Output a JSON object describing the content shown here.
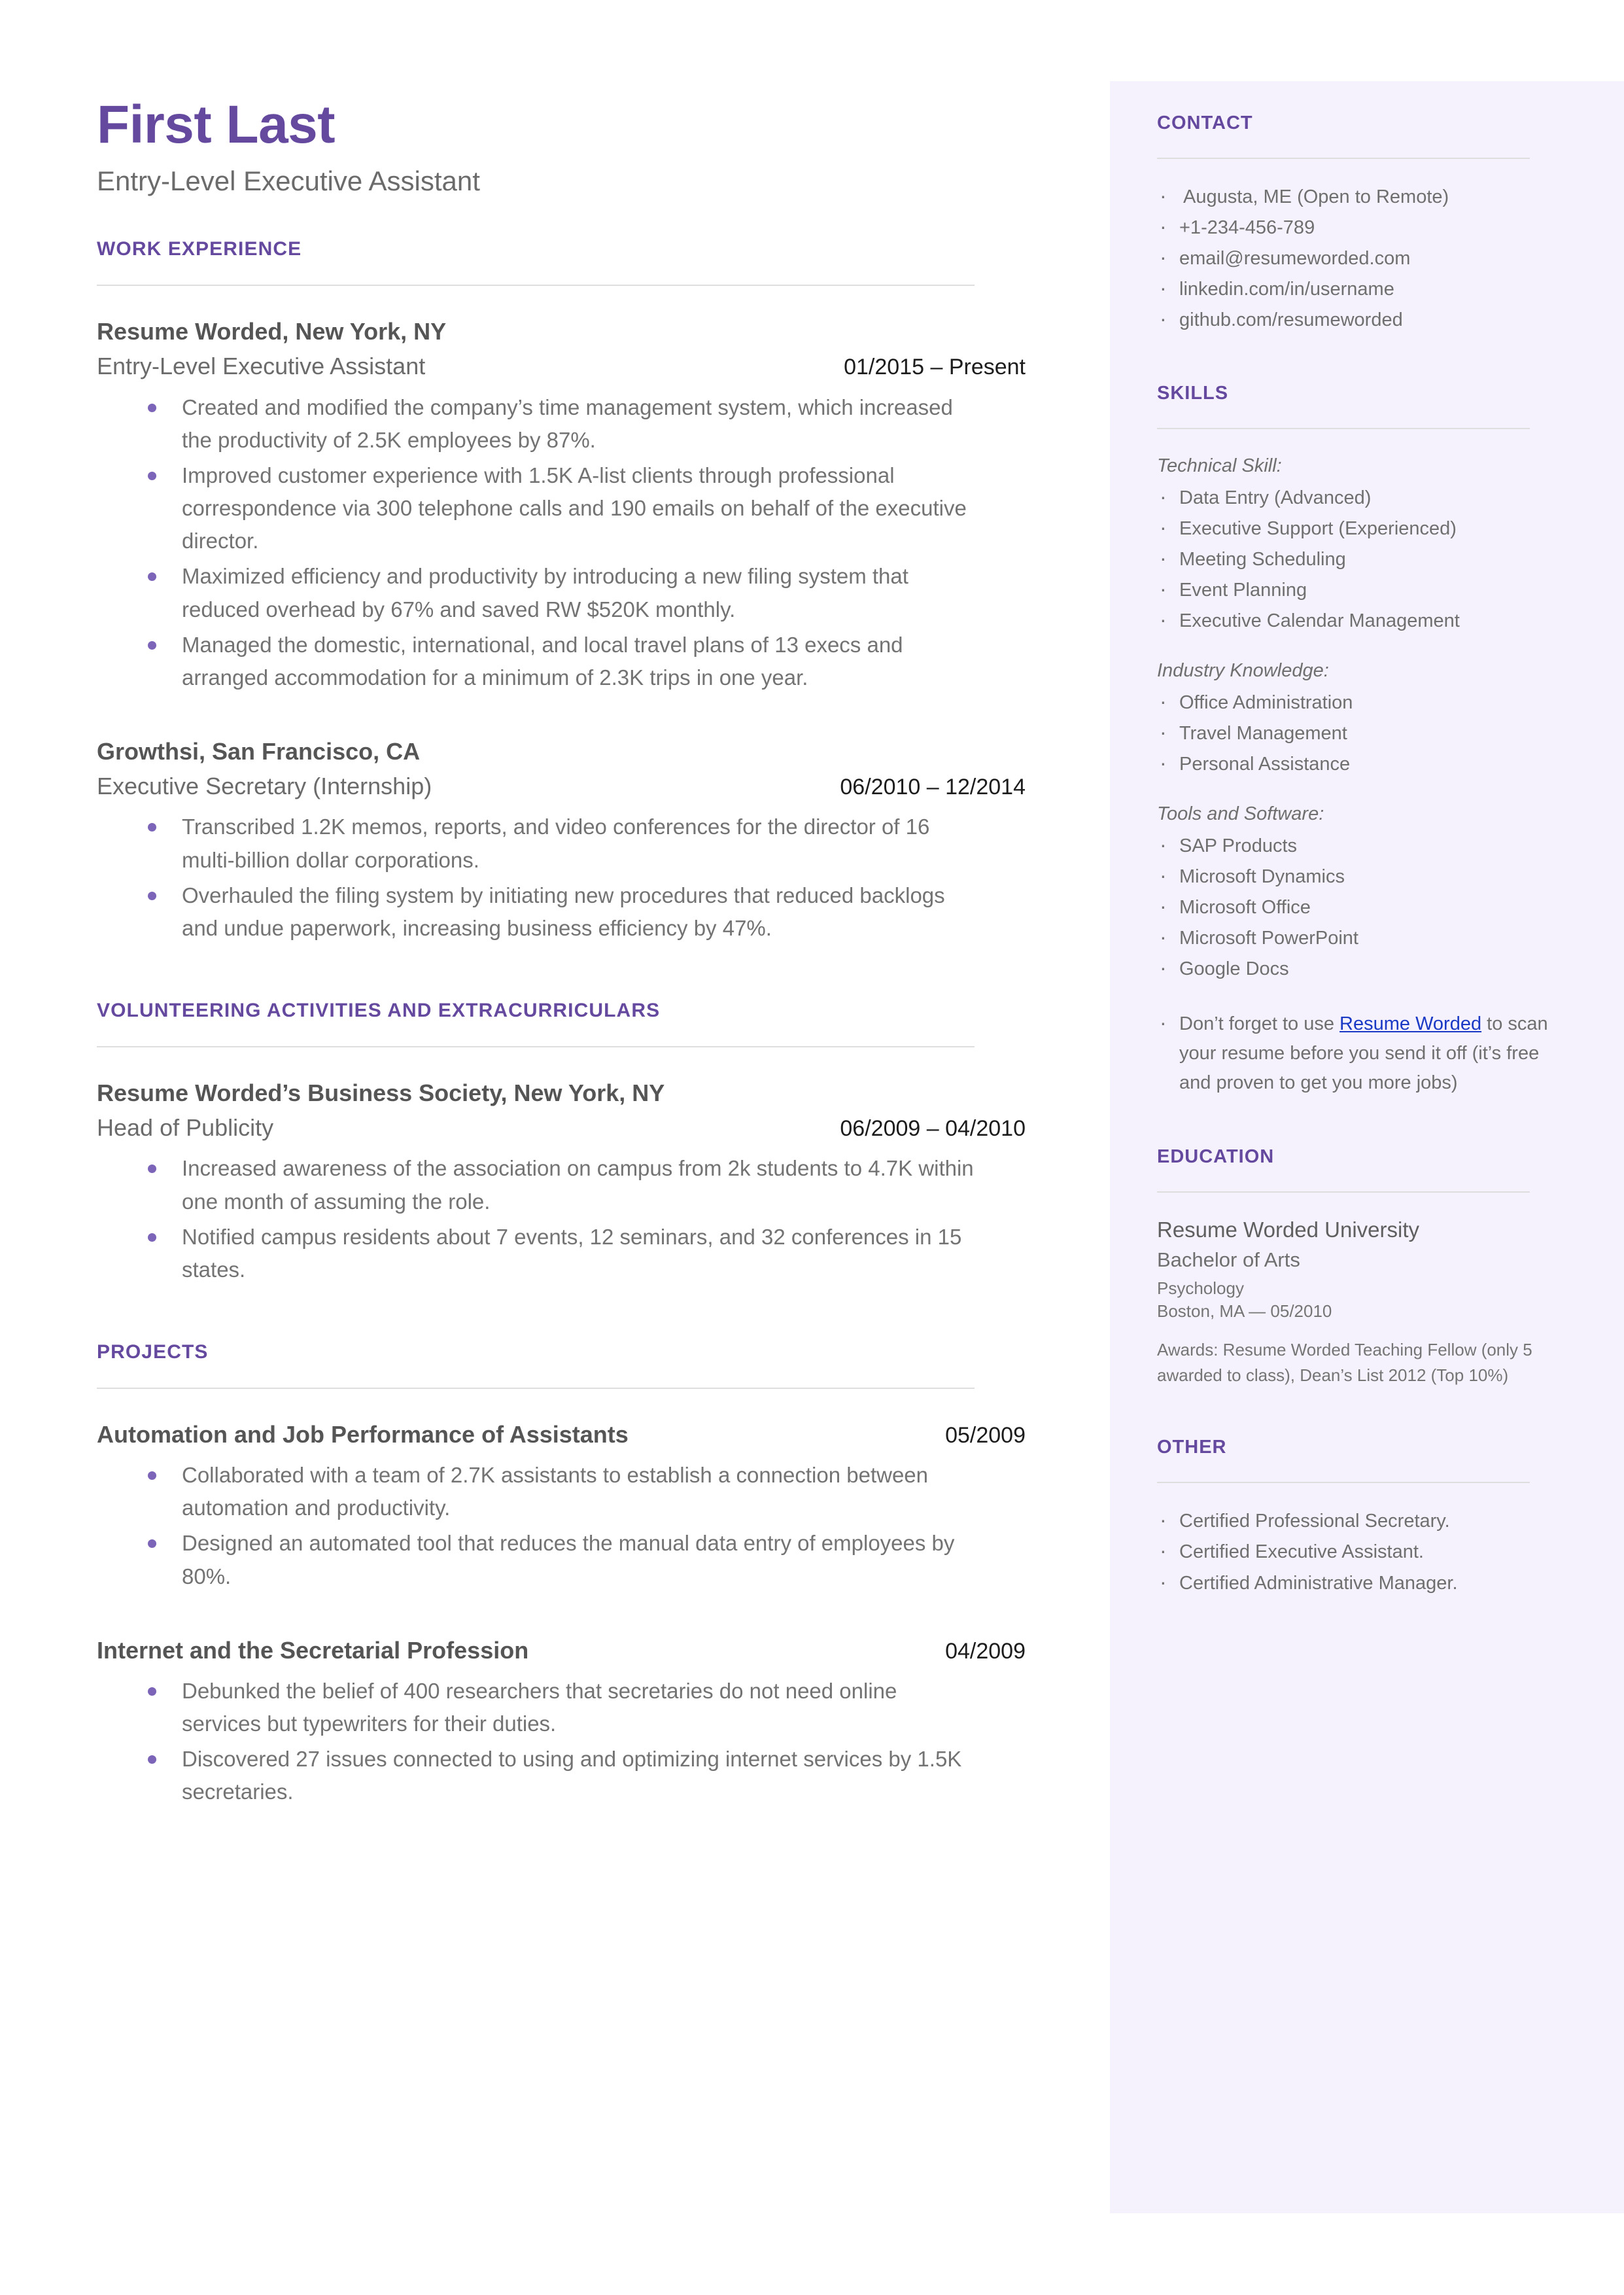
{
  "colors": {
    "accent_purple": "#64499E",
    "bullet_purple": "#7C64B8",
    "sidebar_bg": "#F5F2FD",
    "link_blue": "#1A39C4",
    "body_gray": "#737373",
    "date_black": "#1C1C1C"
  },
  "header": {
    "name": "First Last",
    "headline": "Entry-Level Executive Assistant"
  },
  "sections": {
    "work_experience": {
      "title": "WORK EXPERIENCE",
      "entries": [
        {
          "organization": "Resume Worded, New York, NY",
          "role": "Entry-Level Executive Assistant",
          "date": "01/2015 – Present",
          "bullets": [
            "Created and modified the company’s time management system, which increased the productivity of 2.5K employees by 87%.",
            "Improved customer experience with 1.5K A-list clients through professional correspondence via 300 telephone calls and 190 emails on behalf of the executive director.",
            "Maximized efficiency and productivity by introducing a new filing system that reduced overhead by 67% and saved RW $520K monthly.",
            "Managed the domestic, international, and local travel plans of 13 execs and arranged accommodation for a minimum of 2.3K trips in one year."
          ]
        },
        {
          "organization": "Growthsi, San Francisco, CA",
          "role": "Executive Secretary (Internship)",
          "date": "06/2010 – 12/2014",
          "bullets": [
            "Transcribed 1.2K memos, reports, and video conferences for the director of 16 multi-billion dollar corporations.",
            "Overhauled the filing system by initiating new procedures that reduced backlogs and undue paperwork, increasing business efficiency by 47%."
          ]
        }
      ]
    },
    "volunteering": {
      "title": "VOLUNTEERING ACTIVITIES AND EXTRACURRICULARS",
      "entries": [
        {
          "organization": "Resume Worded’s Business Society, New York, NY",
          "role": "Head of Publicity",
          "date": "06/2009 – 04/2010",
          "bullets": [
            "Increased awareness of the association on campus from 2k students to 4.7K within one month of assuming the role.",
            "Notified campus residents about 7 events, 12 seminars, and 32 conferences in 15 states."
          ]
        }
      ]
    },
    "projects": {
      "title": "PROJECTS",
      "entries": [
        {
          "name": "Automation and Job Performance of Assistants",
          "date": "05/2009",
          "bullets": [
            "Collaborated with a team of 2.7K assistants to establish a connection between automation and productivity.",
            "Designed an automated tool that reduces the manual data entry of employees by 80%."
          ]
        },
        {
          "name": "Internet and the Secretarial Profession",
          "date": "04/2009",
          "bullets": [
            "Debunked the belief of 400 researchers that secretaries do not need online services but typewriters for their duties.",
            "Discovered 27 issues connected to using and optimizing internet services by 1.5K secretaries."
          ]
        }
      ]
    }
  },
  "sidebar": {
    "contact": {
      "title": "CONTACT",
      "items": [
        "Augusta, ME (Open to Remote)",
        "+1-234-456-789",
        "email@resumeworded.com",
        "linkedin.com/in/username",
        "github.com/resumeworded"
      ]
    },
    "skills": {
      "title": "SKILLS",
      "groups": [
        {
          "label": "Technical Skill:",
          "items": [
            "Data Entry (Advanced)",
            "Executive Support (Experienced)",
            "Meeting Scheduling",
            "Event Planning",
            "Executive Calendar Management"
          ]
        },
        {
          "label": "Industry Knowledge:",
          "items": [
            "Office Administration",
            "Travel Management",
            "Personal Assistance"
          ]
        },
        {
          "label": "Tools and Software:",
          "items": [
            "SAP Products",
            "Microsoft Dynamics",
            "Microsoft Office",
            "Microsoft PowerPoint",
            "Google Docs"
          ]
        }
      ],
      "promo": {
        "prefix": "Don’t forget to use ",
        "link_text": "Resume Worded",
        "suffix": " to scan your resume before you send it off (it’s free and proven to get you more jobs)"
      }
    },
    "education": {
      "title": "EDUCATION",
      "school": "Resume Worded University",
      "degree": "Bachelor of Arts",
      "minor": "Psychology",
      "location_date": "Boston, MA — 05/2010",
      "awards": "Awards: Resume Worded Teaching Fellow (only 5 awarded to class), Dean’s List 2012 (Top 10%)"
    },
    "other": {
      "title": "OTHER",
      "items": [
        "Certified Professional Secretary.",
        "Certified Executive Assistant.",
        "Certified Administrative Manager."
      ]
    }
  }
}
